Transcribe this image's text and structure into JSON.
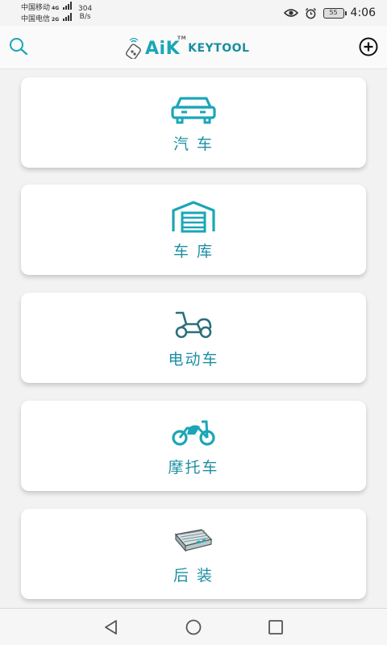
{
  "status_bar": {
    "carrier_1": "中国移动",
    "carrier_2": "中国电信",
    "net_1": "4G",
    "net_2": "2G",
    "speed_value": "304",
    "speed_unit": "B/s",
    "battery": "55",
    "time": "4:06"
  },
  "header": {
    "logo_main": "AiK",
    "logo_tm": "TM",
    "logo_sub": "KEYTOOL"
  },
  "categories": [
    {
      "label": "汽 车",
      "icon": "car-icon"
    },
    {
      "label": "车 库",
      "icon": "garage-icon"
    },
    {
      "label": "电动车",
      "icon": "scooter-icon"
    },
    {
      "label": "摩托车",
      "icon": "motorcycle-icon"
    },
    {
      "label": "后 装",
      "icon": "aftermarket-icon"
    }
  ],
  "colors": {
    "accent": "#1aa6b7",
    "label": "#1d8fa3"
  },
  "nav_bar": [
    "back",
    "home",
    "recents"
  ]
}
